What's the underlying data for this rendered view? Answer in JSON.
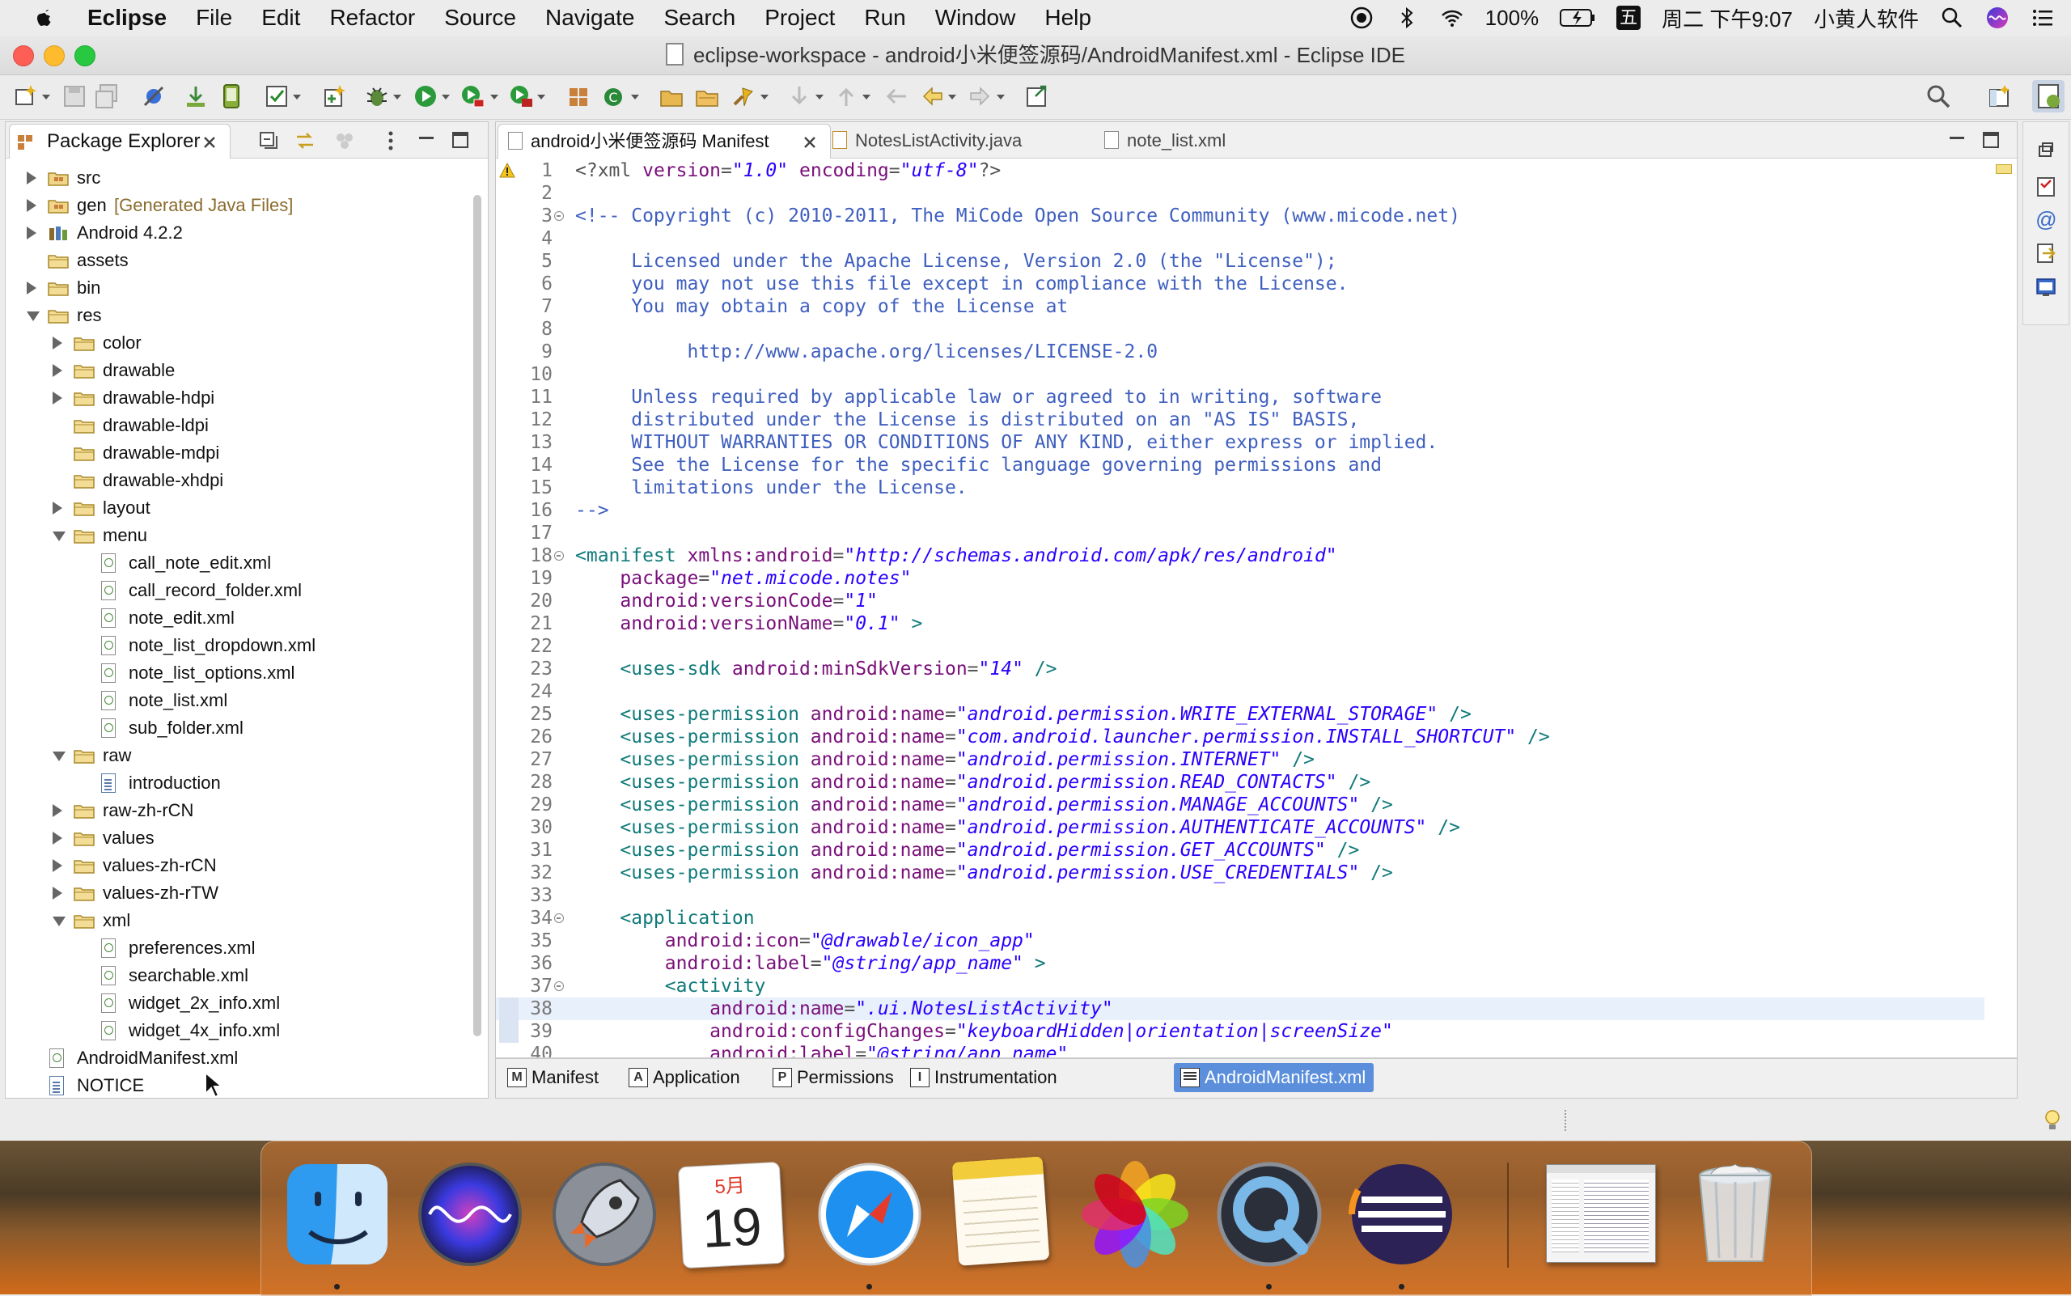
{
  "menubar": {
    "app_name": "Eclipse",
    "items": [
      "File",
      "Edit",
      "Refactor",
      "Source",
      "Navigate",
      "Search",
      "Project",
      "Run",
      "Window",
      "Help"
    ],
    "battery": "100%",
    "input_method": "五",
    "datetime": "周二 下午9:07",
    "user": "小黄人软件"
  },
  "window": {
    "title": "eclipse-workspace - android小米便签源码/AndroidManifest.xml - Eclipse IDE"
  },
  "explorer": {
    "tab_label": "Package Explorer",
    "tree": [
      {
        "label": "src",
        "note": "",
        "depth": 1,
        "twisty": "closed",
        "icon": "package-folder-icon"
      },
      {
        "label": "gen",
        "note": "[Generated Java Files]",
        "depth": 1,
        "twisty": "closed",
        "icon": "package-folder-icon"
      },
      {
        "label": "Android 4.2.2",
        "note": "",
        "depth": 1,
        "twisty": "closed",
        "icon": "library-icon"
      },
      {
        "label": "assets",
        "note": "",
        "depth": 1,
        "twisty": "none",
        "icon": "folder-icon"
      },
      {
        "label": "bin",
        "note": "",
        "depth": 1,
        "twisty": "closed",
        "icon": "folder-icon"
      },
      {
        "label": "res",
        "note": "",
        "depth": 1,
        "twisty": "open",
        "icon": "folder-icon"
      },
      {
        "label": "color",
        "note": "",
        "depth": 2,
        "twisty": "closed",
        "icon": "folder-icon"
      },
      {
        "label": "drawable",
        "note": "",
        "depth": 2,
        "twisty": "closed",
        "icon": "folder-icon"
      },
      {
        "label": "drawable-hdpi",
        "note": "",
        "depth": 2,
        "twisty": "closed",
        "icon": "folder-icon"
      },
      {
        "label": "drawable-ldpi",
        "note": "",
        "depth": 2,
        "twisty": "none",
        "icon": "folder-icon"
      },
      {
        "label": "drawable-mdpi",
        "note": "",
        "depth": 2,
        "twisty": "none",
        "icon": "folder-icon"
      },
      {
        "label": "drawable-xhdpi",
        "note": "",
        "depth": 2,
        "twisty": "none",
        "icon": "folder-icon"
      },
      {
        "label": "layout",
        "note": "",
        "depth": 2,
        "twisty": "closed",
        "icon": "folder-icon"
      },
      {
        "label": "menu",
        "note": "",
        "depth": 2,
        "twisty": "open",
        "icon": "folder-icon"
      },
      {
        "label": "call_note_edit.xml",
        "note": "",
        "depth": 3,
        "twisty": "none",
        "icon": "xml-file-icon"
      },
      {
        "label": "call_record_folder.xml",
        "note": "",
        "depth": 3,
        "twisty": "none",
        "icon": "xml-file-icon"
      },
      {
        "label": "note_edit.xml",
        "note": "",
        "depth": 3,
        "twisty": "none",
        "icon": "xml-file-icon"
      },
      {
        "label": "note_list_dropdown.xml",
        "note": "",
        "depth": 3,
        "twisty": "none",
        "icon": "xml-file-icon"
      },
      {
        "label": "note_list_options.xml",
        "note": "",
        "depth": 3,
        "twisty": "none",
        "icon": "xml-file-icon"
      },
      {
        "label": "note_list.xml",
        "note": "",
        "depth": 3,
        "twisty": "none",
        "icon": "xml-file-icon"
      },
      {
        "label": "sub_folder.xml",
        "note": "",
        "depth": 3,
        "twisty": "none",
        "icon": "xml-file-icon"
      },
      {
        "label": "raw",
        "note": "",
        "depth": 2,
        "twisty": "open",
        "icon": "folder-icon"
      },
      {
        "label": "introduction",
        "note": "",
        "depth": 3,
        "twisty": "none",
        "icon": "text-file-icon"
      },
      {
        "label": "raw-zh-rCN",
        "note": "",
        "depth": 2,
        "twisty": "closed",
        "icon": "folder-icon"
      },
      {
        "label": "values",
        "note": "",
        "depth": 2,
        "twisty": "closed",
        "icon": "folder-icon"
      },
      {
        "label": "values-zh-rCN",
        "note": "",
        "depth": 2,
        "twisty": "closed",
        "icon": "folder-icon"
      },
      {
        "label": "values-zh-rTW",
        "note": "",
        "depth": 2,
        "twisty": "closed",
        "icon": "folder-icon"
      },
      {
        "label": "xml",
        "note": "",
        "depth": 2,
        "twisty": "open",
        "icon": "folder-icon"
      },
      {
        "label": "preferences.xml",
        "note": "",
        "depth": 3,
        "twisty": "none",
        "icon": "xml-file-icon"
      },
      {
        "label": "searchable.xml",
        "note": "",
        "depth": 3,
        "twisty": "none",
        "icon": "xml-file-icon"
      },
      {
        "label": "widget_2x_info.xml",
        "note": "",
        "depth": 3,
        "twisty": "none",
        "icon": "xml-file-icon"
      },
      {
        "label": "widget_4x_info.xml",
        "note": "",
        "depth": 3,
        "twisty": "none",
        "icon": "xml-file-icon"
      },
      {
        "label": "AndroidManifest.xml",
        "note": "",
        "depth": 1,
        "twisty": "none",
        "icon": "xml-file-icon"
      },
      {
        "label": "NOTICE",
        "note": "",
        "depth": 1,
        "twisty": "none",
        "icon": "text-file-icon"
      }
    ]
  },
  "editor": {
    "tabs": [
      {
        "label": "android小米便签源码 Manifest",
        "active": true
      },
      {
        "label": "NotesListActivity.java",
        "active": false
      },
      {
        "label": "note_list.xml",
        "active": false
      }
    ],
    "highlight_line": 38,
    "lines": [
      {
        "n": "1",
        "fold": false,
        "warn": true,
        "segs": [
          [
            "pi",
            "<?xml "
          ],
          [
            "attr",
            "version"
          ],
          [
            "pi",
            "="
          ],
          [
            "val",
            "\"1.0\""
          ],
          [
            "pi",
            " "
          ],
          [
            "attr",
            "encoding"
          ],
          [
            "pi",
            "="
          ],
          [
            "val",
            "\"utf-8\""
          ],
          [
            "pi",
            "?>"
          ]
        ]
      },
      {
        "n": "2",
        "segs": []
      },
      {
        "n": "3",
        "fold": true,
        "segs": [
          [
            "com",
            "<!-- Copyright (c) 2010-2011, The MiCode Open Source Community (www.micode.net)"
          ]
        ]
      },
      {
        "n": "4",
        "segs": []
      },
      {
        "n": "5",
        "segs": [
          [
            "com",
            "     Licensed under the Apache License, Version 2.0 (the \"License\");"
          ]
        ]
      },
      {
        "n": "6",
        "segs": [
          [
            "com",
            "     you may not use this file except in compliance with the License."
          ]
        ]
      },
      {
        "n": "7",
        "segs": [
          [
            "com",
            "     You may obtain a copy of the License at"
          ]
        ]
      },
      {
        "n": "8",
        "segs": []
      },
      {
        "n": "9",
        "segs": [
          [
            "com",
            "          http://www.apache.org/licenses/LICENSE-2.0"
          ]
        ]
      },
      {
        "n": "10",
        "segs": []
      },
      {
        "n": "11",
        "segs": [
          [
            "com",
            "     Unless required by applicable law or agreed to in writing, software"
          ]
        ]
      },
      {
        "n": "12",
        "segs": [
          [
            "com",
            "     distributed under the License is distributed on an \"AS IS\" BASIS,"
          ]
        ]
      },
      {
        "n": "13",
        "segs": [
          [
            "com",
            "     WITHOUT WARRANTIES OR CONDITIONS OF ANY KIND, either express or implied."
          ]
        ]
      },
      {
        "n": "14",
        "segs": [
          [
            "com",
            "     See the License for the specific language governing permissions and"
          ]
        ]
      },
      {
        "n": "15",
        "segs": [
          [
            "com",
            "     limitations under the License."
          ]
        ]
      },
      {
        "n": "16",
        "segs": [
          [
            "com",
            "-->"
          ]
        ]
      },
      {
        "n": "17",
        "segs": []
      },
      {
        "n": "18",
        "fold": true,
        "segs": [
          [
            "tag",
            "<manifest "
          ],
          [
            "attr",
            "xmlns:android"
          ],
          [
            "pi",
            "="
          ],
          [
            "val",
            "\"http://schemas.android.com/apk/res/android\""
          ]
        ]
      },
      {
        "n": "19",
        "segs": [
          [
            "pi",
            "    "
          ],
          [
            "attr",
            "package"
          ],
          [
            "pi",
            "="
          ],
          [
            "val",
            "\"net.micode.notes\""
          ]
        ]
      },
      {
        "n": "20",
        "segs": [
          [
            "pi",
            "    "
          ],
          [
            "attr",
            "android:versionCode"
          ],
          [
            "pi",
            "="
          ],
          [
            "val",
            "\"1\""
          ]
        ]
      },
      {
        "n": "21",
        "segs": [
          [
            "pi",
            "    "
          ],
          [
            "attr",
            "android:versionName"
          ],
          [
            "pi",
            "="
          ],
          [
            "val",
            "\"0.1\""
          ],
          [
            "tag",
            " >"
          ]
        ]
      },
      {
        "n": "22",
        "segs": []
      },
      {
        "n": "23",
        "segs": [
          [
            "pi",
            "    "
          ],
          [
            "tag",
            "<uses-sdk "
          ],
          [
            "attr",
            "android:minSdkVersion"
          ],
          [
            "pi",
            "="
          ],
          [
            "val",
            "\"14\""
          ],
          [
            "tag",
            " />"
          ]
        ]
      },
      {
        "n": "24",
        "segs": []
      },
      {
        "n": "25",
        "segs": [
          [
            "pi",
            "    "
          ],
          [
            "tag",
            "<uses-permission "
          ],
          [
            "attr",
            "android:name"
          ],
          [
            "pi",
            "="
          ],
          [
            "val",
            "\"android.permission.WRITE_EXTERNAL_STORAGE\""
          ],
          [
            "tag",
            " />"
          ]
        ]
      },
      {
        "n": "26",
        "segs": [
          [
            "pi",
            "    "
          ],
          [
            "tag",
            "<uses-permission "
          ],
          [
            "attr",
            "android:name"
          ],
          [
            "pi",
            "="
          ],
          [
            "val",
            "\"com.android.launcher.permission.INSTALL_SHORTCUT\""
          ],
          [
            "tag",
            " />"
          ]
        ]
      },
      {
        "n": "27",
        "segs": [
          [
            "pi",
            "    "
          ],
          [
            "tag",
            "<uses-permission "
          ],
          [
            "attr",
            "android:name"
          ],
          [
            "pi",
            "="
          ],
          [
            "val",
            "\"android.permission.INTERNET\""
          ],
          [
            "tag",
            " />"
          ]
        ]
      },
      {
        "n": "28",
        "segs": [
          [
            "pi",
            "    "
          ],
          [
            "tag",
            "<uses-permission "
          ],
          [
            "attr",
            "android:name"
          ],
          [
            "pi",
            "="
          ],
          [
            "val",
            "\"android.permission.READ_CONTACTS\""
          ],
          [
            "tag",
            " />"
          ]
        ]
      },
      {
        "n": "29",
        "segs": [
          [
            "pi",
            "    "
          ],
          [
            "tag",
            "<uses-permission "
          ],
          [
            "attr",
            "android:name"
          ],
          [
            "pi",
            "="
          ],
          [
            "val",
            "\"android.permission.MANAGE_ACCOUNTS\""
          ],
          [
            "tag",
            " />"
          ]
        ]
      },
      {
        "n": "30",
        "segs": [
          [
            "pi",
            "    "
          ],
          [
            "tag",
            "<uses-permission "
          ],
          [
            "attr",
            "android:name"
          ],
          [
            "pi",
            "="
          ],
          [
            "val",
            "\"android.permission.AUTHENTICATE_ACCOUNTS\""
          ],
          [
            "tag",
            " />"
          ]
        ]
      },
      {
        "n": "31",
        "segs": [
          [
            "pi",
            "    "
          ],
          [
            "tag",
            "<uses-permission "
          ],
          [
            "attr",
            "android:name"
          ],
          [
            "pi",
            "="
          ],
          [
            "val",
            "\"android.permission.GET_ACCOUNTS\""
          ],
          [
            "tag",
            " />"
          ]
        ]
      },
      {
        "n": "32",
        "segs": [
          [
            "pi",
            "    "
          ],
          [
            "tag",
            "<uses-permission "
          ],
          [
            "attr",
            "android:name"
          ],
          [
            "pi",
            "="
          ],
          [
            "val",
            "\"android.permission.USE_CREDENTIALS\""
          ],
          [
            "tag",
            " />"
          ]
        ]
      },
      {
        "n": "33",
        "segs": []
      },
      {
        "n": "34",
        "fold": true,
        "segs": [
          [
            "pi",
            "    "
          ],
          [
            "tag",
            "<application"
          ]
        ]
      },
      {
        "n": "35",
        "segs": [
          [
            "pi",
            "        "
          ],
          [
            "attr",
            "android:icon"
          ],
          [
            "pi",
            "="
          ],
          [
            "val",
            "\"@drawable/icon_app\""
          ]
        ]
      },
      {
        "n": "36",
        "segs": [
          [
            "pi",
            "        "
          ],
          [
            "attr",
            "android:label"
          ],
          [
            "pi",
            "="
          ],
          [
            "val",
            "\"@string/app_name\""
          ],
          [
            "tag",
            " >"
          ]
        ]
      },
      {
        "n": "37",
        "fold": true,
        "segs": [
          [
            "pi",
            "        "
          ],
          [
            "tag",
            "<activity"
          ]
        ]
      },
      {
        "n": "38",
        "segs": [
          [
            "pi",
            "            "
          ],
          [
            "attr",
            "android:name"
          ],
          [
            "pi",
            "="
          ],
          [
            "val",
            "\".ui.NotesListActivity\""
          ]
        ]
      },
      {
        "n": "39",
        "segs": [
          [
            "pi",
            "            "
          ],
          [
            "attr",
            "android:configChanges"
          ],
          [
            "pi",
            "="
          ],
          [
            "val",
            "\"keyboardHidden|orientation|screenSize\""
          ]
        ]
      },
      {
        "n": "40",
        "segs": [
          [
            "pi",
            "            "
          ],
          [
            "attr",
            "android:label"
          ],
          [
            "pi",
            "="
          ],
          [
            "val",
            "\"@string/app_name\""
          ]
        ]
      }
    ],
    "bottom_tabs": [
      {
        "label": "Manifest",
        "glyph": "M",
        "active": false
      },
      {
        "label": "Application",
        "glyph": "A",
        "active": false
      },
      {
        "label": "Permissions",
        "glyph": "P",
        "active": false
      },
      {
        "label": "Instrumentation",
        "glyph": "I",
        "active": false
      },
      {
        "label": "AndroidManifest.xml",
        "glyph": "",
        "active": true
      }
    ]
  },
  "dock": {
    "calendar_month": "5月",
    "calendar_day": "19"
  },
  "colors": {
    "xml_tag": "#117a7a",
    "xml_attr": "#7a0f7a",
    "xml_value": "#2a00ff",
    "comment": "#3f5fbf",
    "active_bottom_tab": "#5b8fdc"
  }
}
